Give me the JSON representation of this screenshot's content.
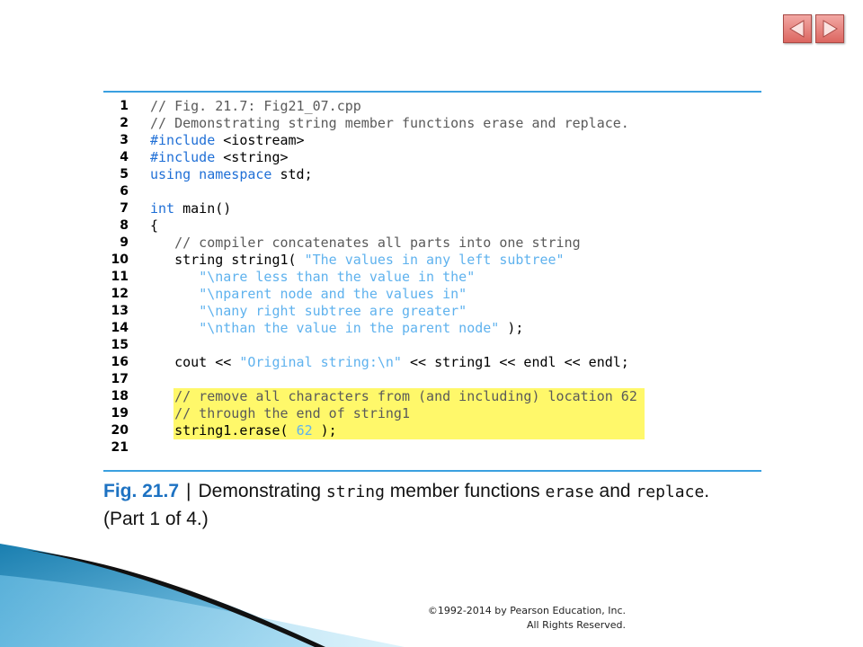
{
  "nav": {
    "prev_label": "Previous slide",
    "next_label": "Next slide"
  },
  "code_lines": [
    {
      "n": "1",
      "tokens": [
        {
          "t": "// Fig. 21.7: Fig21_07.cpp",
          "k": "c"
        }
      ]
    },
    {
      "n": "2",
      "tokens": [
        {
          "t": "// Demonstrating string member functions erase and replace.",
          "k": "c"
        }
      ]
    },
    {
      "n": "3",
      "tokens": [
        {
          "t": "#include",
          "k": "k"
        },
        {
          "t": " <iostream>",
          "k": ""
        }
      ]
    },
    {
      "n": "4",
      "tokens": [
        {
          "t": "#include",
          "k": "k"
        },
        {
          "t": " <string>",
          "k": ""
        }
      ]
    },
    {
      "n": "5",
      "tokens": [
        {
          "t": "using namespace",
          "k": "k"
        },
        {
          "t": " std;",
          "k": ""
        }
      ]
    },
    {
      "n": "6",
      "tokens": []
    },
    {
      "n": "7",
      "tokens": [
        {
          "t": "int",
          "k": "k"
        },
        {
          "t": " main()",
          "k": ""
        }
      ]
    },
    {
      "n": "8",
      "tokens": [
        {
          "t": "{",
          "k": ""
        }
      ]
    },
    {
      "n": "9",
      "tokens": [
        {
          "t": "   ",
          "k": ""
        },
        {
          "t": "// compiler concatenates all parts into one string",
          "k": "c"
        }
      ]
    },
    {
      "n": "10",
      "tokens": [
        {
          "t": "   string string1( ",
          "k": ""
        },
        {
          "t": "\"The values in any left subtree\"",
          "k": "s"
        }
      ]
    },
    {
      "n": "11",
      "tokens": [
        {
          "t": "      ",
          "k": ""
        },
        {
          "t": "\"\\nare less than the value in the\"",
          "k": "s"
        }
      ]
    },
    {
      "n": "12",
      "tokens": [
        {
          "t": "      ",
          "k": ""
        },
        {
          "t": "\"\\nparent node and the values in\"",
          "k": "s"
        }
      ]
    },
    {
      "n": "13",
      "tokens": [
        {
          "t": "      ",
          "k": ""
        },
        {
          "t": "\"\\nany right subtree are greater\"",
          "k": "s"
        }
      ]
    },
    {
      "n": "14",
      "tokens": [
        {
          "t": "      ",
          "k": ""
        },
        {
          "t": "\"\\nthan the value in the parent node\"",
          "k": "s"
        },
        {
          "t": " );",
          "k": ""
        }
      ]
    },
    {
      "n": "15",
      "tokens": []
    },
    {
      "n": "16",
      "tokens": [
        {
          "t": "   cout << ",
          "k": ""
        },
        {
          "t": "\"Original string:\\n\"",
          "k": "s"
        },
        {
          "t": " << string1 << endl << endl;",
          "k": ""
        }
      ]
    },
    {
      "n": "17",
      "tokens": []
    },
    {
      "n": "18",
      "hl": true,
      "tokens": [
        {
          "t": "   ",
          "k": ""
        },
        {
          "t": "// remove all characters from (and including) location 62",
          "k": "c"
        }
      ]
    },
    {
      "n": "19",
      "hl": true,
      "tokens": [
        {
          "t": "   ",
          "k": ""
        },
        {
          "t": "// through the end of string1",
          "k": "c"
        }
      ]
    },
    {
      "n": "20",
      "hl": true,
      "tokens": [
        {
          "t": "   string1.erase( ",
          "k": ""
        },
        {
          "t": "62",
          "k": "s"
        },
        {
          "t": " );",
          "k": ""
        }
      ]
    },
    {
      "n": "21",
      "tokens": []
    }
  ],
  "caption": {
    "fig": "Fig. 21.7",
    "sep": "|",
    "p1": "Demonstrating ",
    "m1": "string",
    "p2": " member functions ",
    "m2": "erase",
    "p3": " and ",
    "m3": "replace",
    "p4": ".",
    "line2": "(Part 1 of 4.)"
  },
  "copyright": {
    "line1": "©1992-2014 by Pearson Education, Inc.",
    "line2": "All Rights Reserved."
  },
  "colors": {
    "accent_blue": "#3aa0e0",
    "highlight_yellow": "#fff86a",
    "keyword": "#1f6fd6",
    "string_literal": "#5fb2ee",
    "comment": "#5a5a5a",
    "nav_red": "#dc6660"
  }
}
